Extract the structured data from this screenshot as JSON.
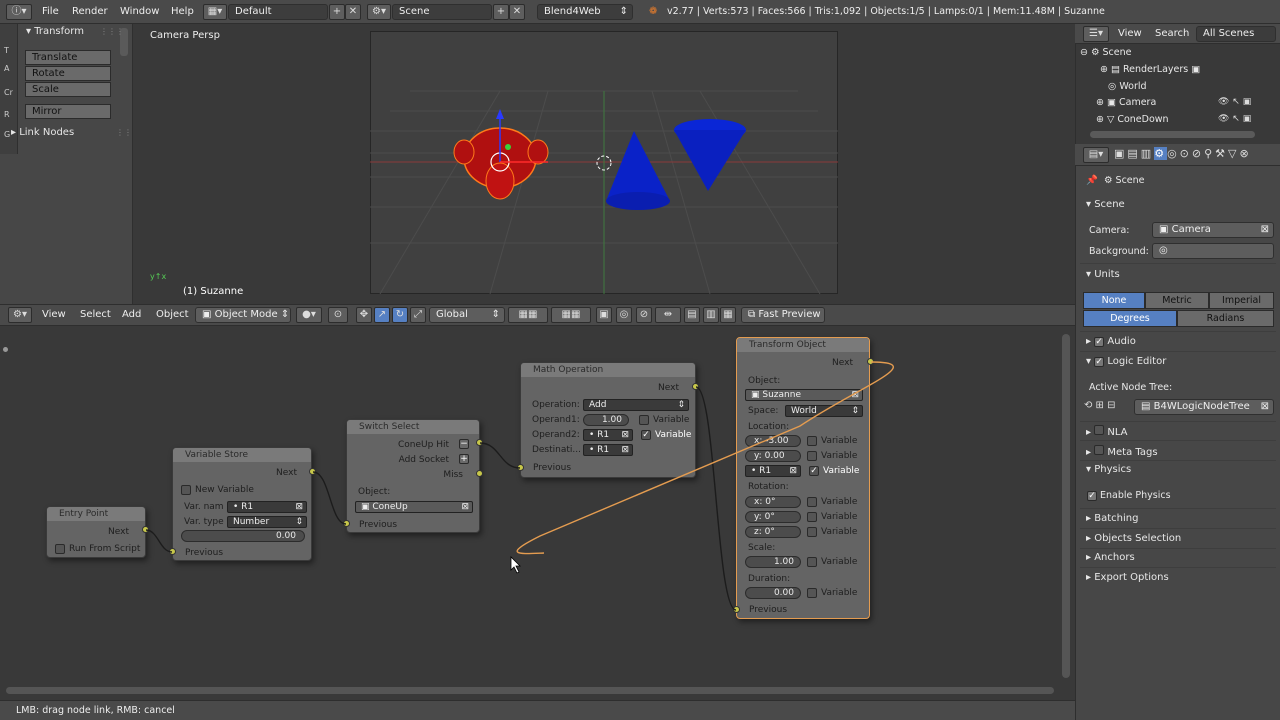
{
  "topbar": {
    "menus": [
      "File",
      "Render",
      "Window",
      "Help"
    ],
    "layout": "Default",
    "scene": "Scene",
    "engine": "Blend4Web",
    "stats": "v2.77 | Verts:573 | Faces:566 | Tris:1,092 | Objects:1/5 | Lamps:0/1 | Mem:11.48M | Suzanne"
  },
  "toolshelf": {
    "tabs": [
      "T",
      "A",
      "Cr",
      "R",
      "G"
    ],
    "transform_title": "Transform",
    "buttons": [
      "Translate",
      "Rotate",
      "Scale",
      "Mirror"
    ],
    "link_nodes": "Link Nodes"
  },
  "viewport": {
    "label": "Camera Persp",
    "object_label": "(1) Suzanne"
  },
  "node_header": {
    "menus": [
      "View",
      "Select",
      "Add",
      "Object"
    ],
    "mode": "Object Mode",
    "orientation": "Global",
    "fast_preview": "Fast Preview"
  },
  "nodes": {
    "entry": {
      "title": "Entry Point",
      "next": "Next",
      "run_from_script": "Run From Script"
    },
    "varstore": {
      "title": "Variable Store",
      "next": "Next",
      "new_variable": "New Variable",
      "var_name_label": "Var. nam",
      "var_name": "R1",
      "var_type_label": "Var. type",
      "var_type": "Number",
      "value": "0.00",
      "previous": "Previous"
    },
    "switch": {
      "title": "Switch Select",
      "coneup_hit": "ConeUp Hit",
      "add_socket": "Add Socket",
      "miss": "Miss",
      "object_label": "Object:",
      "object": "ConeUp",
      "previous": "Previous"
    },
    "math": {
      "title": "Math Operation",
      "next": "Next",
      "operation_label": "Operation:",
      "operation": "Add",
      "operand1_label": "Operand1:",
      "operand1": "1.00",
      "operand2_label": "Operand2:",
      "operand2": "R1",
      "dest_label": "Destinati...",
      "dest": "R1",
      "variable": "Variable",
      "previous": "Previous"
    },
    "transform": {
      "title": "Transform Object",
      "next": "Next",
      "object_label": "Object:",
      "object": "Suzanne",
      "space_label": "Space:",
      "space": "World",
      "location_label": "Location:",
      "loc_x": "-3.00",
      "loc_y": "0.00",
      "loc_z": "R1",
      "rotation_label": "Rotation:",
      "rot_x": "0°",
      "rot_y": "0°",
      "rot_z": "0°",
      "scale_label": "Scale:",
      "scale": "1.00",
      "duration_label": "Duration:",
      "duration": "0.00",
      "variable": "Variable",
      "previous": "Previous",
      "x": "x:",
      "y": "y:",
      "z": "z:"
    }
  },
  "outliner": {
    "menus": [
      "View",
      "Search"
    ],
    "filter": "All Scenes",
    "items": [
      "Scene",
      "RenderLayers",
      "World",
      "Camera",
      "ConeDown"
    ]
  },
  "props": {
    "context": "Scene",
    "scene_section": "Scene",
    "camera_label": "Camera:",
    "camera": "Camera",
    "background_label": "Background:",
    "units_section": "Units",
    "unit_systems": [
      "None",
      "Metric",
      "Imperial"
    ],
    "rotation_units": [
      "Degrees",
      "Radians"
    ],
    "audio": "Audio",
    "logic_editor": "Logic Editor",
    "active_node_tree_label": "Active Node Tree:",
    "node_tree": "B4WLogicNodeTree",
    "nla": "NLA",
    "meta_tags": "Meta Tags",
    "physics": "Physics",
    "enable_physics": "Enable Physics",
    "batching": "Batching",
    "objects_selection": "Objects Selection",
    "anchors": "Anchors",
    "export_options": "Export Options"
  },
  "status": "LMB: drag node link, RMB: cancel"
}
